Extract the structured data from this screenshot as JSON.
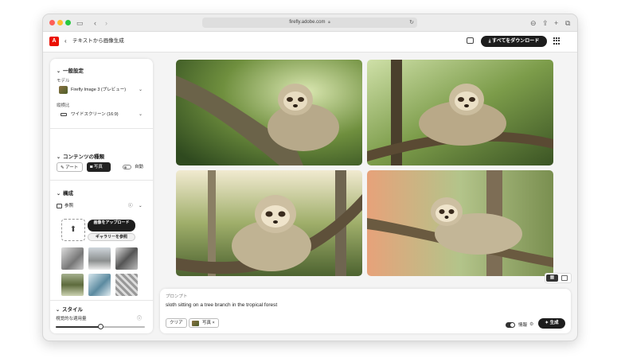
{
  "browser": {
    "url": "firefly.adobe.com",
    "lock_icon": "lock-icon"
  },
  "header": {
    "logo": "A",
    "back_icon": "‹",
    "title": "テキストから画像生成",
    "download_all_label": "すべてをダウンロード"
  },
  "sidebar": {
    "general": {
      "heading": "一般設定",
      "model_label": "モデル",
      "model_value": "Firefly Image 3 (プレビュー)",
      "aspect_label": "縦横比",
      "aspect_value": "ワイドスクリーン (16:9)"
    },
    "content_type": {
      "heading": "コンテンツの種類",
      "art_label": "アート",
      "photo_label": "写真",
      "auto_label": "自動"
    },
    "composition": {
      "heading": "構成",
      "reference_label": "参照",
      "upload_label": "画像をアップロード",
      "gallery_label": "ギャラリーを参照"
    },
    "style": {
      "heading": "スタイル",
      "intensity_label": "視覚的な適用量",
      "intensity_value": 0.5
    }
  },
  "prompt": {
    "label": "プロンプト",
    "text": "sloth sitting on a tree branch in the tropical forest",
    "clear_label": "クリア",
    "tag_label": "写真",
    "ai_label": "情報",
    "generate_label": "生成"
  },
  "colors": {
    "accent": "#eb1000",
    "dark_button": "#1d1d1d",
    "panel_bg": "#f4f4f4"
  }
}
